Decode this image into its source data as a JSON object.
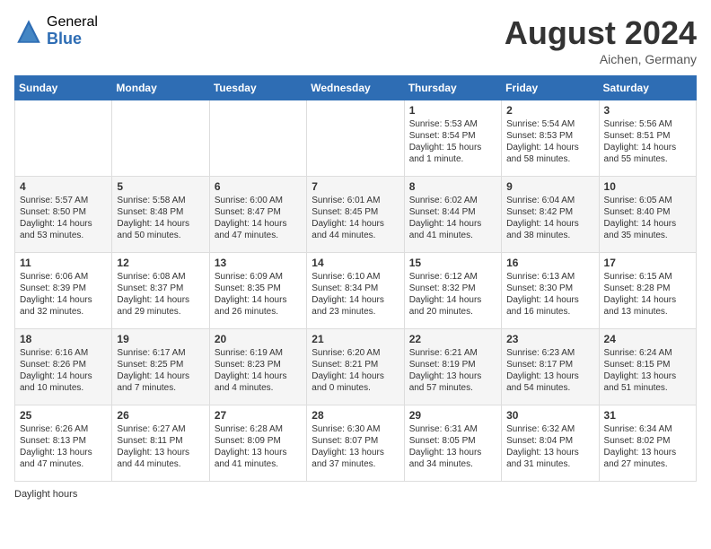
{
  "header": {
    "logo_general": "General",
    "logo_blue": "Blue",
    "month_year": "August 2024",
    "location": "Aichen, Germany"
  },
  "days_of_week": [
    "Sunday",
    "Monday",
    "Tuesday",
    "Wednesday",
    "Thursday",
    "Friday",
    "Saturday"
  ],
  "footer": "Daylight hours",
  "weeks": [
    [
      {
        "day": "",
        "text": ""
      },
      {
        "day": "",
        "text": ""
      },
      {
        "day": "",
        "text": ""
      },
      {
        "day": "",
        "text": ""
      },
      {
        "day": "1",
        "text": "Sunrise: 5:53 AM\nSunset: 8:54 PM\nDaylight: 15 hours and 1 minute."
      },
      {
        "day": "2",
        "text": "Sunrise: 5:54 AM\nSunset: 8:53 PM\nDaylight: 14 hours and 58 minutes."
      },
      {
        "day": "3",
        "text": "Sunrise: 5:56 AM\nSunset: 8:51 PM\nDaylight: 14 hours and 55 minutes."
      }
    ],
    [
      {
        "day": "4",
        "text": "Sunrise: 5:57 AM\nSunset: 8:50 PM\nDaylight: 14 hours and 53 minutes."
      },
      {
        "day": "5",
        "text": "Sunrise: 5:58 AM\nSunset: 8:48 PM\nDaylight: 14 hours and 50 minutes."
      },
      {
        "day": "6",
        "text": "Sunrise: 6:00 AM\nSunset: 8:47 PM\nDaylight: 14 hours and 47 minutes."
      },
      {
        "day": "7",
        "text": "Sunrise: 6:01 AM\nSunset: 8:45 PM\nDaylight: 14 hours and 44 minutes."
      },
      {
        "day": "8",
        "text": "Sunrise: 6:02 AM\nSunset: 8:44 PM\nDaylight: 14 hours and 41 minutes."
      },
      {
        "day": "9",
        "text": "Sunrise: 6:04 AM\nSunset: 8:42 PM\nDaylight: 14 hours and 38 minutes."
      },
      {
        "day": "10",
        "text": "Sunrise: 6:05 AM\nSunset: 8:40 PM\nDaylight: 14 hours and 35 minutes."
      }
    ],
    [
      {
        "day": "11",
        "text": "Sunrise: 6:06 AM\nSunset: 8:39 PM\nDaylight: 14 hours and 32 minutes."
      },
      {
        "day": "12",
        "text": "Sunrise: 6:08 AM\nSunset: 8:37 PM\nDaylight: 14 hours and 29 minutes."
      },
      {
        "day": "13",
        "text": "Sunrise: 6:09 AM\nSunset: 8:35 PM\nDaylight: 14 hours and 26 minutes."
      },
      {
        "day": "14",
        "text": "Sunrise: 6:10 AM\nSunset: 8:34 PM\nDaylight: 14 hours and 23 minutes."
      },
      {
        "day": "15",
        "text": "Sunrise: 6:12 AM\nSunset: 8:32 PM\nDaylight: 14 hours and 20 minutes."
      },
      {
        "day": "16",
        "text": "Sunrise: 6:13 AM\nSunset: 8:30 PM\nDaylight: 14 hours and 16 minutes."
      },
      {
        "day": "17",
        "text": "Sunrise: 6:15 AM\nSunset: 8:28 PM\nDaylight: 14 hours and 13 minutes."
      }
    ],
    [
      {
        "day": "18",
        "text": "Sunrise: 6:16 AM\nSunset: 8:26 PM\nDaylight: 14 hours and 10 minutes."
      },
      {
        "day": "19",
        "text": "Sunrise: 6:17 AM\nSunset: 8:25 PM\nDaylight: 14 hours and 7 minutes."
      },
      {
        "day": "20",
        "text": "Sunrise: 6:19 AM\nSunset: 8:23 PM\nDaylight: 14 hours and 4 minutes."
      },
      {
        "day": "21",
        "text": "Sunrise: 6:20 AM\nSunset: 8:21 PM\nDaylight: 14 hours and 0 minutes."
      },
      {
        "day": "22",
        "text": "Sunrise: 6:21 AM\nSunset: 8:19 PM\nDaylight: 13 hours and 57 minutes."
      },
      {
        "day": "23",
        "text": "Sunrise: 6:23 AM\nSunset: 8:17 PM\nDaylight: 13 hours and 54 minutes."
      },
      {
        "day": "24",
        "text": "Sunrise: 6:24 AM\nSunset: 8:15 PM\nDaylight: 13 hours and 51 minutes."
      }
    ],
    [
      {
        "day": "25",
        "text": "Sunrise: 6:26 AM\nSunset: 8:13 PM\nDaylight: 13 hours and 47 minutes."
      },
      {
        "day": "26",
        "text": "Sunrise: 6:27 AM\nSunset: 8:11 PM\nDaylight: 13 hours and 44 minutes."
      },
      {
        "day": "27",
        "text": "Sunrise: 6:28 AM\nSunset: 8:09 PM\nDaylight: 13 hours and 41 minutes."
      },
      {
        "day": "28",
        "text": "Sunrise: 6:30 AM\nSunset: 8:07 PM\nDaylight: 13 hours and 37 minutes."
      },
      {
        "day": "29",
        "text": "Sunrise: 6:31 AM\nSunset: 8:05 PM\nDaylight: 13 hours and 34 minutes."
      },
      {
        "day": "30",
        "text": "Sunrise: 6:32 AM\nSunset: 8:04 PM\nDaylight: 13 hours and 31 minutes."
      },
      {
        "day": "31",
        "text": "Sunrise: 6:34 AM\nSunset: 8:02 PM\nDaylight: 13 hours and 27 minutes."
      }
    ]
  ]
}
